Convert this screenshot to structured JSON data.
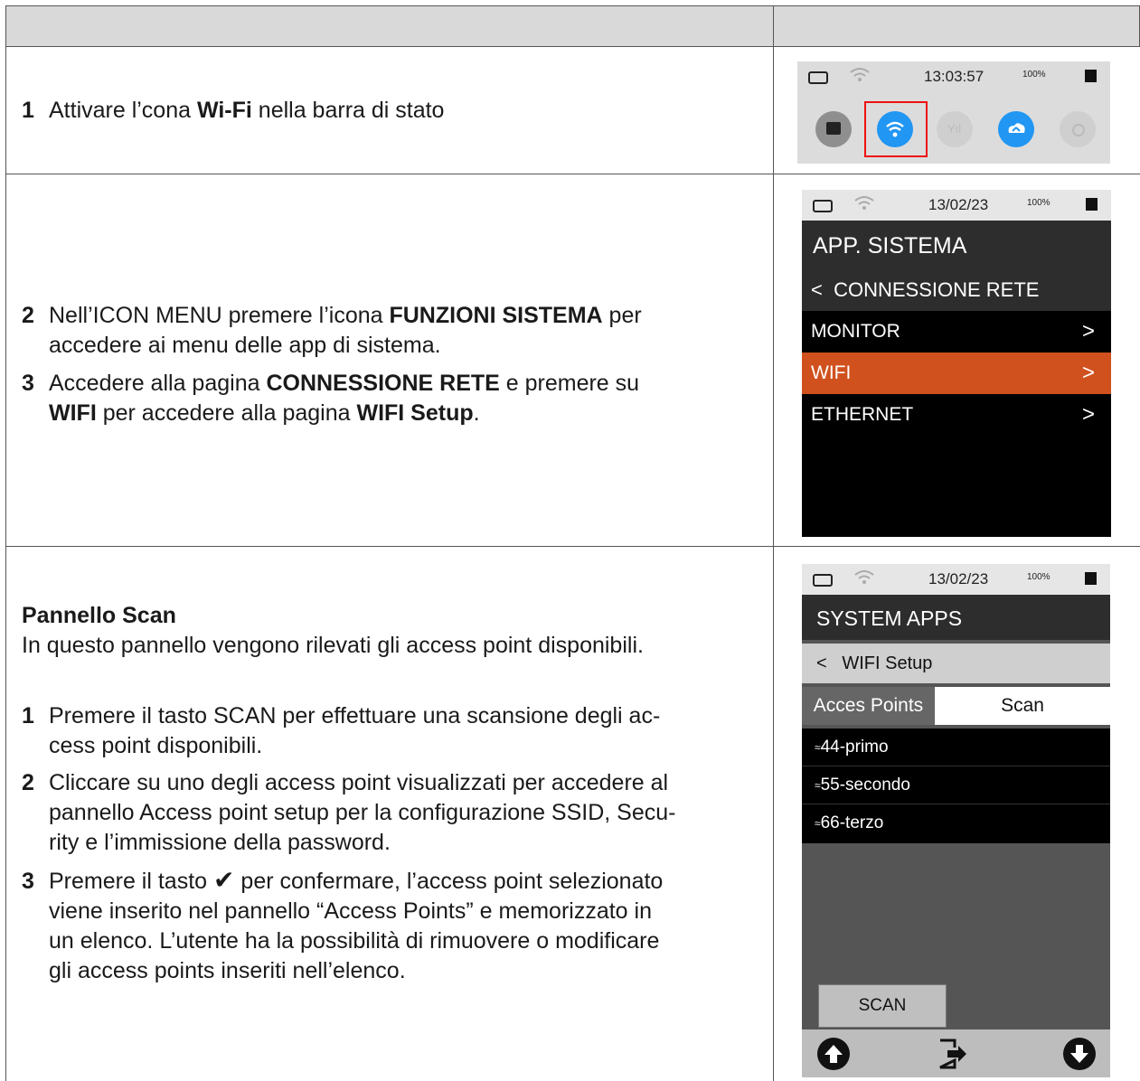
{
  "row1": {
    "step": {
      "num": "1",
      "pre": "Attivare l’cona ",
      "bold": "Wi-Fi",
      "post": " nella barra di stato"
    },
    "screen": {
      "status": {
        "time": "13:03:57",
        "battery_pct": "100%"
      },
      "icons": [
        "ethernet-icon",
        "wifi-icon",
        "cellular-icon",
        "cloud-upload-icon",
        "gps-icon"
      ]
    }
  },
  "row2": {
    "step2": {
      "num": "2",
      "pre": "Nell’ICON MENU premere l’icona ",
      "bold": "FUNZIONI SISTEMA",
      "post": " per",
      "line2": "accedere ai menu delle app di sistema."
    },
    "step3": {
      "num": "3",
      "pre": "Accedere alla pagina ",
      "bold": "CONNESSIONE RETE",
      "post": " e premere su",
      "bold2": "WIFI",
      "mid": " per accedere alla pagina ",
      "bold3": "WIFI Setup",
      "end": "."
    },
    "screen": {
      "status": {
        "date": "13/02/23",
        "battery_pct": "100%"
      },
      "title": "APP. SISTEMA",
      "back_label": "CONNESSIONE RETE",
      "items": [
        {
          "label": "MONITOR"
        },
        {
          "label": "WIFI"
        },
        {
          "label": "ETHERNET"
        }
      ],
      "selected_color": "#d0511e"
    }
  },
  "row3": {
    "heading": "Pannello Scan",
    "intro": "In questo pannello vengono rilevati gli access point disponibili.",
    "steps": [
      {
        "num": "1",
        "l1": "Premere il tasto SCAN per effettuare una scansione degli ac-",
        "l2": "cess point disponibili."
      },
      {
        "num": "2",
        "l1": "Cliccare su uno degli access point visualizzati per accedere al",
        "l2": "pannello Access point setup per la configurazione SSID, Secu-",
        "l3": "rity e l’immissione della password."
      },
      {
        "num": "3",
        "l1a": "Premere il tasto ",
        "l1b": " per confermare, l’access point selezionato",
        "l2": "viene inserito nel pannello “Access Points” e memorizzato in",
        "l3": "un elenco. L’utente ha la possibilità di rimuovere o modificare",
        "l4": "gli access points inseriti nell’elenco."
      }
    ],
    "screen": {
      "status": {
        "date": "13/02/23",
        "battery_pct": "100%"
      },
      "title": "SYSTEM APPS",
      "back_label": "WIFI Setup",
      "tab_access_points": "Acces Points",
      "tab_scan": "Scan",
      "access_points": [
        "44-primo",
        "55-secondo",
        "66-terzo"
      ],
      "scan_button": "SCAN"
    }
  }
}
